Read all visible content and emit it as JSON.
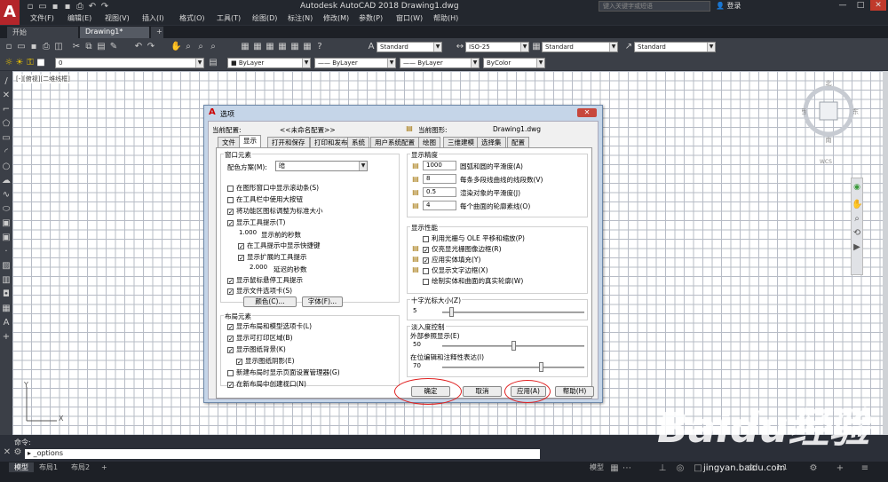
{
  "app": {
    "title": "Autodesk AutoCAD 2018   Drawing1.dwg",
    "logo": "A",
    "search_placeholder": "键入关键字或短语",
    "login": "登录",
    "window_buttons": [
      "—",
      "□",
      "✕"
    ]
  },
  "menu": [
    "文件(F)",
    "编辑(E)",
    "视图(V)",
    "插入(I)",
    "格式(O)",
    "工具(T)",
    "绘图(D)",
    "标注(N)",
    "修改(M)",
    "参数(P)",
    "窗口(W)",
    "帮助(H)"
  ],
  "doc_tabs": [
    {
      "label": "开始"
    },
    {
      "label": "Drawing1*"
    },
    {
      "label": "+"
    }
  ],
  "toolbar": {
    "text_style": "Standard",
    "dim_style": "ISO-25",
    "table_style": "Standard",
    "mleader_style": "Standard",
    "layer": "0",
    "color": "ByLayer",
    "linetype": "ByLayer",
    "lineweight": "ByLayer",
    "plotstyle": "ByColor"
  },
  "viewport_label": "[-][俯视][二维线框]",
  "viewcube": {
    "n": "北",
    "s": "南",
    "w": "西",
    "e": "东",
    "wcs": "WCS"
  },
  "ucs": {
    "x": "X",
    "y": "Y"
  },
  "command": {
    "history_label": "命令:",
    "input": "_options"
  },
  "layout_tabs": [
    {
      "label": "模型"
    },
    {
      "label": "布局1"
    },
    {
      "label": "布局2"
    },
    {
      "label": "+"
    }
  ],
  "status": {
    "model": "模型",
    "scale": "1:1"
  },
  "watermark": {
    "main": "Baidu经验",
    "sub": "jingyan.baidu.com"
  },
  "dialog": {
    "title": "选项",
    "current_profile_label": "当前配置:",
    "current_profile": "<<未命名配置>>",
    "current_drawing_label": "当前图形:",
    "current_drawing": "Drawing1.dwg",
    "close": "✕",
    "tabs": [
      "文件",
      "显示",
      "打开和保存",
      "打印和发布",
      "系统",
      "用户系统配置",
      "绘图",
      "三维建模",
      "选择集",
      "配置"
    ],
    "active_tab": 1,
    "window_elements": {
      "title": "窗口元素",
      "color_scheme_label": "配色方案(M):",
      "color_scheme": "暗",
      "checkboxes": [
        {
          "label": "在图形窗口中显示滚动条(S)",
          "checked": false
        },
        {
          "label": "在工具栏中使用大按钮",
          "checked": false
        },
        {
          "label": "将功能区图标调整为标准大小",
          "checked": true
        },
        {
          "label": "显示工具提示(T)",
          "checked": true
        }
      ],
      "tooltip_delay_value": "1.000",
      "tooltip_delay_label": "显示前的秒数",
      "sub_checkboxes": [
        {
          "label": "在工具提示中显示快捷键",
          "checked": true
        },
        {
          "label": "显示扩展的工具提示",
          "checked": true
        }
      ],
      "ext_delay_value": "2.000",
      "ext_delay_label": "延迟的秒数",
      "checkboxes2": [
        {
          "label": "显示鼠标悬停工具提示",
          "checked": true
        },
        {
          "label": "显示文件选项卡(S)",
          "checked": true
        }
      ],
      "colors_button": "颜色(C)...",
      "fonts_button": "字体(F)..."
    },
    "layout_elements": {
      "title": "布局元素",
      "checkboxes": [
        {
          "label": "显示布局和模型选项卡(L)",
          "checked": true
        },
        {
          "label": "显示可打印区域(B)",
          "checked": true
        },
        {
          "label": "显示图纸背景(K)",
          "checked": true
        }
      ],
      "sub_checkbox": {
        "label": "显示图纸阴影(E)",
        "checked": true
      },
      "checkboxes2": [
        {
          "label": "新建布局时显示页面设置管理器(G)",
          "checked": false
        },
        {
          "label": "在新布局中创建视口(N)",
          "checked": true
        }
      ]
    },
    "display_resolution": {
      "title": "显示精度",
      "rows": [
        {
          "value": "1000",
          "label": "圆弧和圆的平滑度(A)"
        },
        {
          "value": "8",
          "label": "每条多段线曲线的线段数(V)"
        },
        {
          "value": "0.5",
          "label": "渲染对象的平滑度(J)"
        },
        {
          "value": "4",
          "label": "每个曲面的轮廓素线(O)"
        }
      ]
    },
    "display_performance": {
      "title": "显示性能",
      "checkboxes": [
        {
          "label": "利用光栅与 OLE 平移和缩放(P)",
          "checked": false
        },
        {
          "label": "仅亮显光栅图像边框(R)",
          "checked": true
        },
        {
          "label": "应用实体填充(Y)",
          "checked": true
        },
        {
          "label": "仅显示文字边框(X)",
          "checked": false
        },
        {
          "label": "绘制实体和曲面的真实轮廓(W)",
          "checked": false
        }
      ]
    },
    "crosshair": {
      "title": "十字光标大小(Z)",
      "value": "5",
      "slider": 0.05
    },
    "fade_control": {
      "title": "淡入度控制",
      "xref_label": "外部参照显示(E)",
      "xref_value": "50",
      "xref_slider": 0.5,
      "inplace_label": "在位编辑和注释性表达(I)",
      "inplace_value": "70",
      "inplace_slider": 0.7
    },
    "buttons": {
      "ok": "确定",
      "cancel": "取消",
      "apply": "应用(A)",
      "help": "帮助(H)"
    }
  }
}
